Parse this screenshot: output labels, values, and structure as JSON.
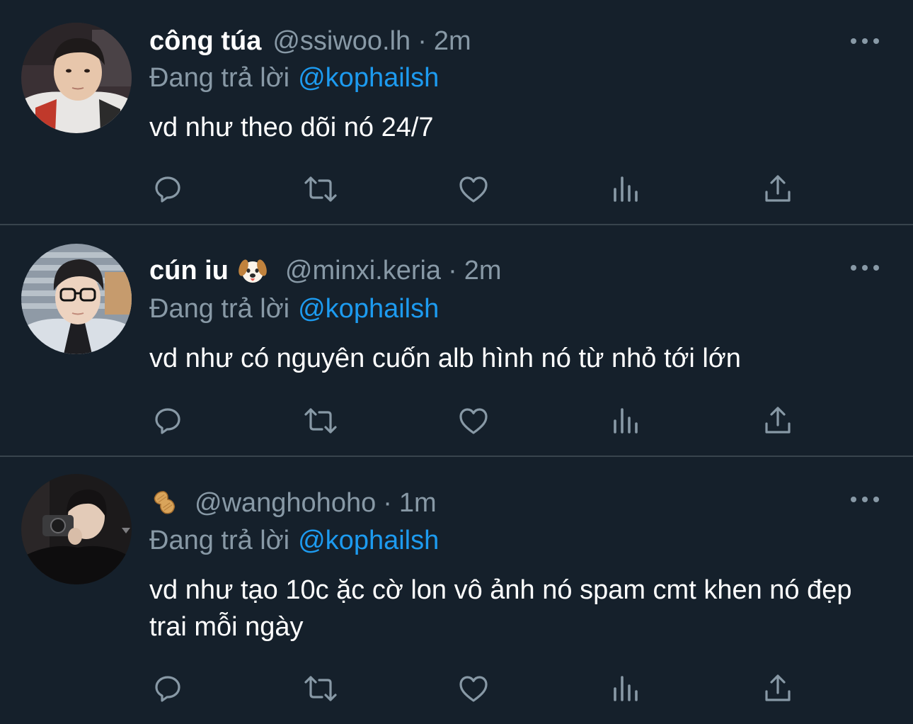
{
  "colors": {
    "background": "#15202b",
    "divider": "#38444d",
    "secondary_text": "#8899a6",
    "accent": "#1d9bf0"
  },
  "tweets": [
    {
      "display_name": "công túa",
      "display_name_emoji": "",
      "handle": "@ssiwoo.lh",
      "separator": "·",
      "time": "2m",
      "reply_prefix": "Đang trả lời",
      "reply_target": "@kophailsh",
      "text": "vd như theo dõi nó 24/7",
      "actions": [
        "reply-icon",
        "retweet-icon",
        "like-icon",
        "views-icon",
        "share-icon"
      ]
    },
    {
      "display_name": "cún iu",
      "display_name_emoji": "dog-face-emoji",
      "handle": "@minxi.keria",
      "separator": "·",
      "time": "2m",
      "reply_prefix": "Đang trả lời",
      "reply_target": "@kophailsh",
      "text": "vd như có nguyên cuốn alb hình nó từ nhỏ tới lớn",
      "actions": [
        "reply-icon",
        "retweet-icon",
        "like-icon",
        "views-icon",
        "share-icon"
      ]
    },
    {
      "display_name": "",
      "display_name_emoji": "peanut-emoji",
      "handle": "@wanghohoho",
      "separator": "·",
      "time": "1m",
      "reply_prefix": "Đang trả lời",
      "reply_target": "@kophailsh",
      "text": "vd như tạo 10c ặc cờ lon vô ảnh nó spam cmt khen nó đẹp trai mỗi ngày",
      "actions": [
        "reply-icon",
        "retweet-icon",
        "like-icon",
        "views-icon",
        "share-icon"
      ]
    }
  ]
}
